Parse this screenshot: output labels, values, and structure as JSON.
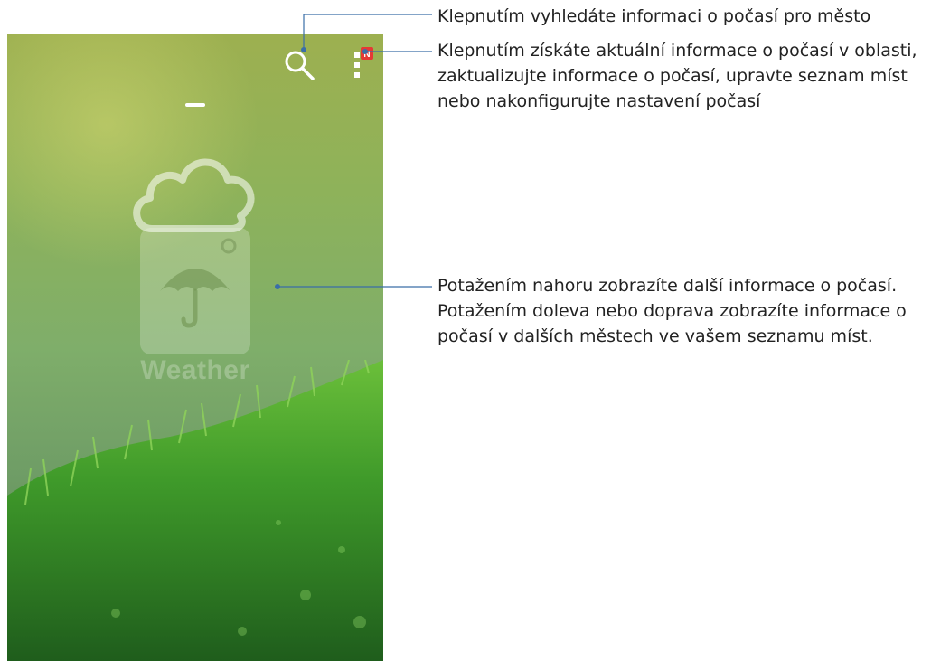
{
  "app": {
    "name": "Weather",
    "menu_badge": "N"
  },
  "icons": {
    "search": "search-icon",
    "menu": "overflow-menu-icon",
    "cloud": "cloud-icon",
    "umbrella": "umbrella-icon"
  },
  "colors": {
    "callout_line": "#3a6ea8",
    "badge": "#e53935"
  },
  "callouts": {
    "search": [
      "Klepnutím vyhledáte informaci o počasí pro město"
    ],
    "menu": [
      "Klepnutím získáte aktuální informace o počasí v oblasti,",
      "zaktualizujte informace o počasí, upravte seznam míst",
      "nebo nakonfigurujte nastavení počasí"
    ],
    "swipe": [
      "Potažením nahoru zobrazíte další informace o počasí.",
      "Potažením doleva nebo doprava zobrazíte informace o",
      "počasí v dalších městech ve vašem seznamu míst."
    ]
  }
}
